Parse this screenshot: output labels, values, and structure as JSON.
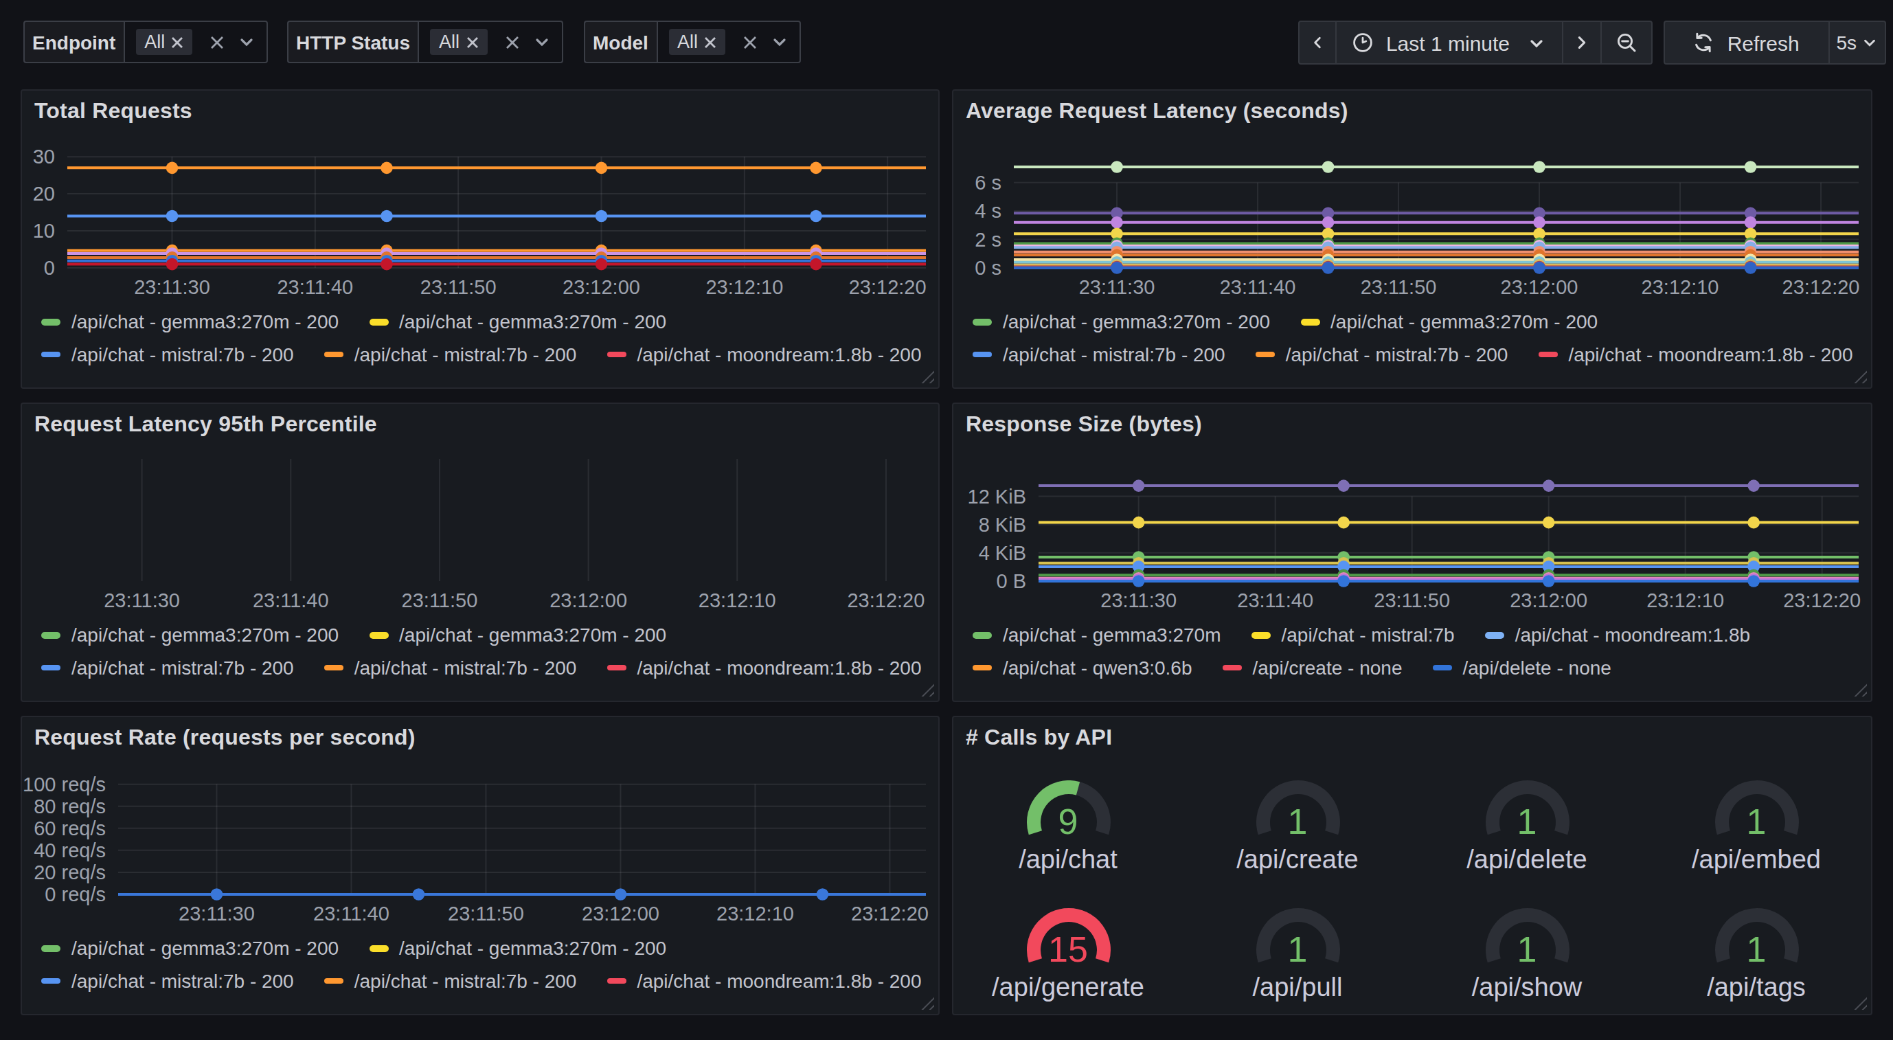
{
  "toolbar": {
    "filters": [
      {
        "label": "Endpoint",
        "value": "All"
      },
      {
        "label": "HTTP Status",
        "value": "All"
      },
      {
        "label": "Model",
        "value": "All"
      }
    ],
    "time_range": "Last 1 minute",
    "refresh_label": "Refresh",
    "refresh_interval": "5s",
    "icons": [
      "chevron-left-icon",
      "clock-icon",
      "chevron-down-icon",
      "chevron-right-icon",
      "zoom-out-icon",
      "refresh-icon"
    ]
  },
  "colors": {
    "page_bg": "#111217",
    "panel_bg": "#181B20",
    "panel_border": "#25272e",
    "text_primary": "#D8D9DD",
    "text_secondary": "#9DA2AD",
    "legend_text": "#C2C4CD",
    "grid": "rgba(204,204,220,0.10)",
    "green": "#73BF69",
    "red": "#F2495C"
  },
  "chart_data": [
    {
      "id": "total-requests",
      "type": "line",
      "title": "Total Requests",
      "x_tick_labels": [
        "23:11:30",
        "23:11:40",
        "23:11:50",
        "23:12:00",
        "23:12:10",
        "23:12:20"
      ],
      "sample_times": [
        "23:11:30",
        "23:11:45",
        "23:12:00",
        "23:12:15"
      ],
      "y_ticks": [
        {
          "v": 0,
          "label": "0"
        },
        {
          "v": 10,
          "label": "10"
        },
        {
          "v": 20,
          "label": "20"
        },
        {
          "v": 30,
          "label": "30"
        }
      ],
      "ylim": [
        0,
        33
      ],
      "axis_gutter": 33,
      "series": [
        {
          "color": "#FF9830",
          "values": [
            27,
            27,
            27,
            27
          ]
        },
        {
          "color": "#5794F2",
          "values": [
            14,
            14,
            14,
            14
          ]
        },
        {
          "color": "#FF9830",
          "values": [
            4.7,
            4.7,
            4.7,
            4.7
          ]
        },
        {
          "color": "#CA95E5",
          "values": [
            3.9,
            3.9,
            3.9,
            3.9
          ]
        },
        {
          "color": "#E0752D",
          "values": [
            2.8,
            2.8,
            2.8,
            2.8
          ]
        },
        {
          "color": "#3274D9",
          "values": [
            1.9,
            1.9,
            1.9,
            1.9
          ]
        },
        {
          "color": "#C4162A",
          "values": [
            1.0,
            1.0,
            1.0,
            1.0
          ]
        }
      ],
      "legend_rows": [
        [
          {
            "label": "/api/chat - gemma3:270m - 200",
            "color": "#73BF69"
          },
          {
            "label": "/api/chat - gemma3:270m - 200",
            "color": "#FADE2A"
          }
        ],
        [
          {
            "label": "/api/chat - mistral:7b - 200",
            "color": "#5794F2"
          },
          {
            "label": "/api/chat - mistral:7b - 200",
            "color": "#FF9830"
          },
          {
            "label": "/api/chat - moondream:1.8b - 200",
            "color": "#F2495C"
          }
        ]
      ]
    },
    {
      "id": "avg-latency",
      "type": "line",
      "title": "Average Request Latency (seconds)",
      "x_tick_labels": [
        "23:11:30",
        "23:11:40",
        "23:11:50",
        "23:12:00",
        "23:12:10",
        "23:12:20"
      ],
      "sample_times": [
        "23:11:30",
        "23:11:45",
        "23:12:00",
        "23:12:15"
      ],
      "y_ticks": [
        {
          "v": 0,
          "label": "0 s"
        },
        {
          "v": 2,
          "label": "2 s"
        },
        {
          "v": 4,
          "label": "4 s"
        },
        {
          "v": 6,
          "label": "6 s"
        }
      ],
      "ylim": [
        0,
        8.6
      ],
      "axis_gutter": 44,
      "series": [
        {
          "color": "#C9E8BF",
          "values": [
            7.1,
            7.1,
            7.1,
            7.1
          ]
        },
        {
          "color": "#6E5BA5",
          "values": [
            3.85,
            3.85,
            3.85,
            3.85
          ]
        },
        {
          "color": "#C085E0",
          "values": [
            3.2,
            3.2,
            3.2,
            3.2
          ]
        },
        {
          "color": "#F2D54B",
          "values": [
            2.4,
            2.4,
            2.4,
            2.4
          ]
        },
        {
          "color": "#4F9A48",
          "values": [
            1.72,
            1.72,
            1.72,
            1.72
          ]
        },
        {
          "color": "#F0B6E4",
          "values": [
            1.55,
            1.55,
            1.55,
            1.55
          ]
        },
        {
          "color": "#86AEE8",
          "values": [
            1.44,
            1.44,
            1.44,
            1.44
          ]
        },
        {
          "color": "#F2916F",
          "values": [
            1.12,
            1.12,
            1.12,
            1.12
          ]
        },
        {
          "color": "#E0752D",
          "values": [
            0.9,
            0.9,
            0.9,
            0.9
          ]
        },
        {
          "color": "#F5E6A8",
          "values": [
            0.58,
            0.58,
            0.58,
            0.58
          ]
        },
        {
          "color": "#7EC4D4",
          "values": [
            0.4,
            0.4,
            0.4,
            0.4
          ]
        },
        {
          "color": "#DBB95C",
          "values": [
            0.2,
            0.2,
            0.2,
            0.2
          ]
        },
        {
          "color": "#B8342E",
          "values": [
            0.07,
            0.07,
            0.07,
            0.07
          ]
        },
        {
          "color": "#7A5FA8",
          "values": [
            0.03,
            0.03,
            0.03,
            0.03
          ]
        },
        {
          "color": "#2E63C4",
          "values": [
            0.0,
            0.0,
            0.0,
            0.0
          ]
        }
      ],
      "legend_rows": [
        [
          {
            "label": "/api/chat - gemma3:270m - 200",
            "color": "#73BF69"
          },
          {
            "label": "/api/chat - gemma3:270m - 200",
            "color": "#FADE2A"
          }
        ],
        [
          {
            "label": "/api/chat - mistral:7b - 200",
            "color": "#5794F2"
          },
          {
            "label": "/api/chat - mistral:7b - 200",
            "color": "#FF9830"
          },
          {
            "label": "/api/chat - moondream:1.8b - 200",
            "color": "#F2495C"
          }
        ]
      ]
    },
    {
      "id": "latency-p95",
      "type": "line",
      "title": "Request Latency 95th Percentile",
      "x_tick_labels": [
        "23:11:30",
        "23:11:40",
        "23:11:50",
        "23:12:00",
        "23:12:10",
        "23:12:20"
      ],
      "sample_times": [],
      "y_ticks": [],
      "ylim": [
        0,
        1
      ],
      "axis_gutter": 8,
      "series": [],
      "legend_rows": [
        [
          {
            "label": "/api/chat - gemma3:270m - 200",
            "color": "#73BF69"
          },
          {
            "label": "/api/chat - gemma3:270m - 200",
            "color": "#FADE2A"
          }
        ],
        [
          {
            "label": "/api/chat - mistral:7b - 200",
            "color": "#5794F2"
          },
          {
            "label": "/api/chat - mistral:7b - 200",
            "color": "#FF9830"
          },
          {
            "label": "/api/chat - moondream:1.8b - 200",
            "color": "#F2495C"
          }
        ]
      ]
    },
    {
      "id": "response-size",
      "type": "line",
      "title": "Response Size (bytes)",
      "x_tick_labels": [
        "23:11:30",
        "23:11:40",
        "23:11:50",
        "23:12:00",
        "23:12:10",
        "23:12:20"
      ],
      "sample_times": [
        "23:11:30",
        "23:11:45",
        "23:12:00",
        "23:12:15"
      ],
      "y_ticks": [
        {
          "v": 0,
          "label": "0 B"
        },
        {
          "v": 4,
          "label": "4 KiB"
        },
        {
          "v": 8,
          "label": "8 KiB"
        },
        {
          "v": 12,
          "label": "12 KiB"
        }
      ],
      "ylim": [
        0,
        17.3
      ],
      "axis_gutter": 62,
      "series": [
        {
          "color": "#7F6FB5",
          "values": [
            13.5,
            13.5,
            13.5,
            13.5
          ]
        },
        {
          "color": "#F2D54B",
          "values": [
            8.3,
            8.3,
            8.3,
            8.3
          ]
        },
        {
          "color": "#73BF69",
          "values": [
            3.4,
            3.4,
            3.4,
            3.4
          ]
        },
        {
          "color": "#D6C150",
          "values": [
            2.55,
            2.55,
            2.55,
            2.55
          ]
        },
        {
          "color": "#5794F2",
          "values": [
            2.05,
            2.05,
            2.05,
            2.05
          ]
        },
        {
          "color": "#4F9A48",
          "values": [
            0.85,
            0.85,
            0.85,
            0.85
          ]
        },
        {
          "color": "#E685B8",
          "values": [
            0.42,
            0.42,
            0.42,
            0.42
          ]
        },
        {
          "color": "#B877D9",
          "values": [
            0.22,
            0.22,
            0.22,
            0.22
          ]
        },
        {
          "color": "#3274D9",
          "values": [
            0.0,
            0.0,
            0.0,
            0.0
          ]
        }
      ],
      "legend_rows": [
        [
          {
            "label": "/api/chat - gemma3:270m",
            "color": "#73BF69"
          },
          {
            "label": "/api/chat - mistral:7b",
            "color": "#FADE2A"
          },
          {
            "label": "/api/chat - moondream:1.8b",
            "color": "#7EB2F5"
          }
        ],
        [
          {
            "label": "/api/chat - qwen3:0.6b",
            "color": "#FF9830"
          },
          {
            "label": "/api/create - none",
            "color": "#F2495C"
          },
          {
            "label": "/api/delete - none",
            "color": "#3274D9"
          }
        ]
      ]
    },
    {
      "id": "request-rate",
      "type": "line",
      "title": "Request Rate (requests per second)",
      "x_tick_labels": [
        "23:11:30",
        "23:11:40",
        "23:11:50",
        "23:12:00",
        "23:12:10",
        "23:12:20"
      ],
      "sample_times": [
        "23:11:30",
        "23:11:45",
        "23:12:00",
        "23:12:15"
      ],
      "y_ticks": [
        {
          "v": 0,
          "label": "0 req/s"
        },
        {
          "v": 20,
          "label": "20 req/s"
        },
        {
          "v": 40,
          "label": "40 req/s"
        },
        {
          "v": 60,
          "label": "60 req/s"
        },
        {
          "v": 80,
          "label": "80 req/s"
        },
        {
          "v": 100,
          "label": "100 req/s"
        }
      ],
      "ylim": [
        0,
        111
      ],
      "axis_gutter": 70,
      "series": [
        {
          "color": "#3A77D9",
          "values": [
            0,
            0,
            0,
            0
          ]
        }
      ],
      "legend_rows": [
        [
          {
            "label": "/api/chat - gemma3:270m - 200",
            "color": "#73BF69"
          },
          {
            "label": "/api/chat - gemma3:270m - 200",
            "color": "#FADE2A"
          }
        ],
        [
          {
            "label": "/api/chat - mistral:7b - 200",
            "color": "#5794F2"
          },
          {
            "label": "/api/chat - mistral:7b - 200",
            "color": "#FF9830"
          },
          {
            "label": "/api/chat - moondream:1.8b - 200",
            "color": "#F2495C"
          }
        ]
      ]
    },
    {
      "id": "calls-by-api",
      "type": "gauge",
      "title": "# Calls by API",
      "gauge_min": 1,
      "gauge_max": 15,
      "gauges": [
        {
          "label": "/api/chat",
          "value": 9,
          "color": "#73BF69"
        },
        {
          "label": "/api/create",
          "value": 1,
          "color": "#73BF69"
        },
        {
          "label": "/api/delete",
          "value": 1,
          "color": "#73BF69"
        },
        {
          "label": "/api/embed",
          "value": 1,
          "color": "#73BF69"
        },
        {
          "label": "/api/generate",
          "value": 15,
          "color": "#F2495C"
        },
        {
          "label": "/api/pull",
          "value": 1,
          "color": "#73BF69"
        },
        {
          "label": "/api/show",
          "value": 1,
          "color": "#73BF69"
        },
        {
          "label": "/api/tags",
          "value": 1,
          "color": "#73BF69"
        }
      ]
    }
  ]
}
